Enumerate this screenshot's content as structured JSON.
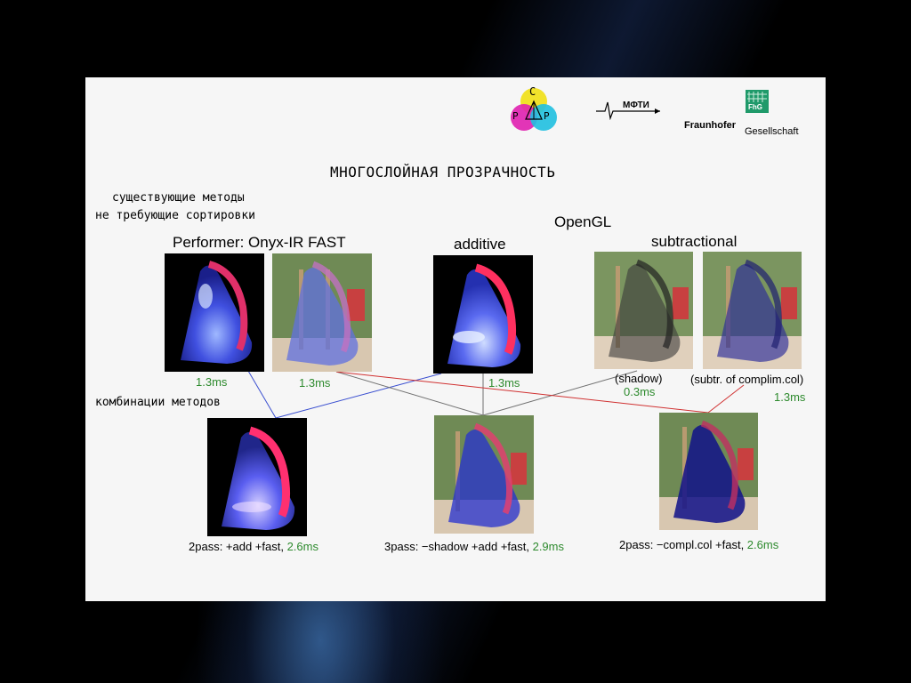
{
  "logos": {
    "csp_letters": [
      "С",
      "Р",
      "Р"
    ],
    "mfti": "МФТИ",
    "fhg_badge": "FhG",
    "fraunhofer": "Fraunhofer",
    "gesellschaft": "Gesellschaft"
  },
  "title": "МНОГОСЛОЙНАЯ ПРОЗРАЧНОСТЬ",
  "left_heading": {
    "line1": "существующие методы",
    "line2": "не требующие сортировки"
  },
  "combinations_label": "комбинации методов",
  "groups": {
    "opengl": "OpenGL",
    "performer": "Performer: Onyx-IR FAST",
    "additive": "additive",
    "subtractional": "subtractional"
  },
  "top_times": {
    "performer_black": "1.3ms",
    "performer_scene": "1.3ms",
    "additive": "1.3ms",
    "shadow_label": "(shadow)",
    "shadow_time": "0.3ms",
    "compl_label": "(subtr. of complim.col)",
    "compl_time": "1.3ms"
  },
  "bottom": [
    {
      "label": "2pass: +add +fast, ",
      "time": "2.6ms"
    },
    {
      "label": "3pass: −shadow +add +fast, ",
      "time": "2.9ms"
    },
    {
      "label": "2pass: −compl.col +fast, ",
      "time": "2.6ms"
    }
  ],
  "colors": {
    "time_green": "#2d8a2d",
    "line_blue": "#3a4fd0",
    "line_red": "#d03030",
    "line_grey": "#707070"
  }
}
